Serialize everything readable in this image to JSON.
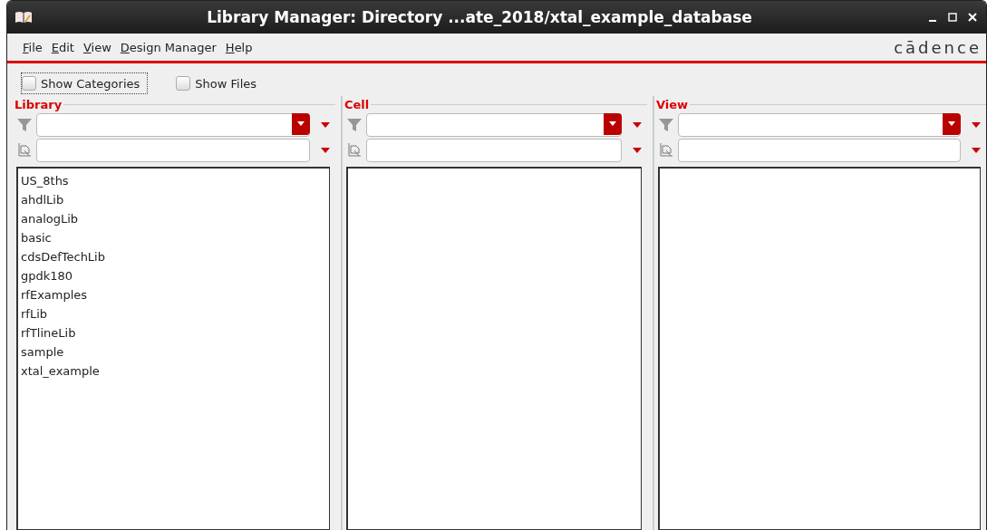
{
  "window": {
    "title": "Library Manager: Directory ...ate_2018/xtal_example_database"
  },
  "menu": [
    "File",
    "Edit",
    "View",
    "Design Manager",
    "Help"
  ],
  "logo": "cādence",
  "options": [
    {
      "label": "Show Categories",
      "checked": false,
      "focused": true
    },
    {
      "label": "Show Files",
      "checked": false,
      "focused": false
    }
  ],
  "panels": [
    {
      "title": "Library",
      "items": [
        "US_8ths",
        "ahdlLib",
        "analogLib",
        "basic",
        "cdsDefTechLib",
        "gpdk180",
        "rfExamples",
        "rfLib",
        "rfTlineLib",
        "sample",
        "xtal_example"
      ]
    },
    {
      "title": "Cell"
    },
    {
      "title": "View"
    }
  ]
}
